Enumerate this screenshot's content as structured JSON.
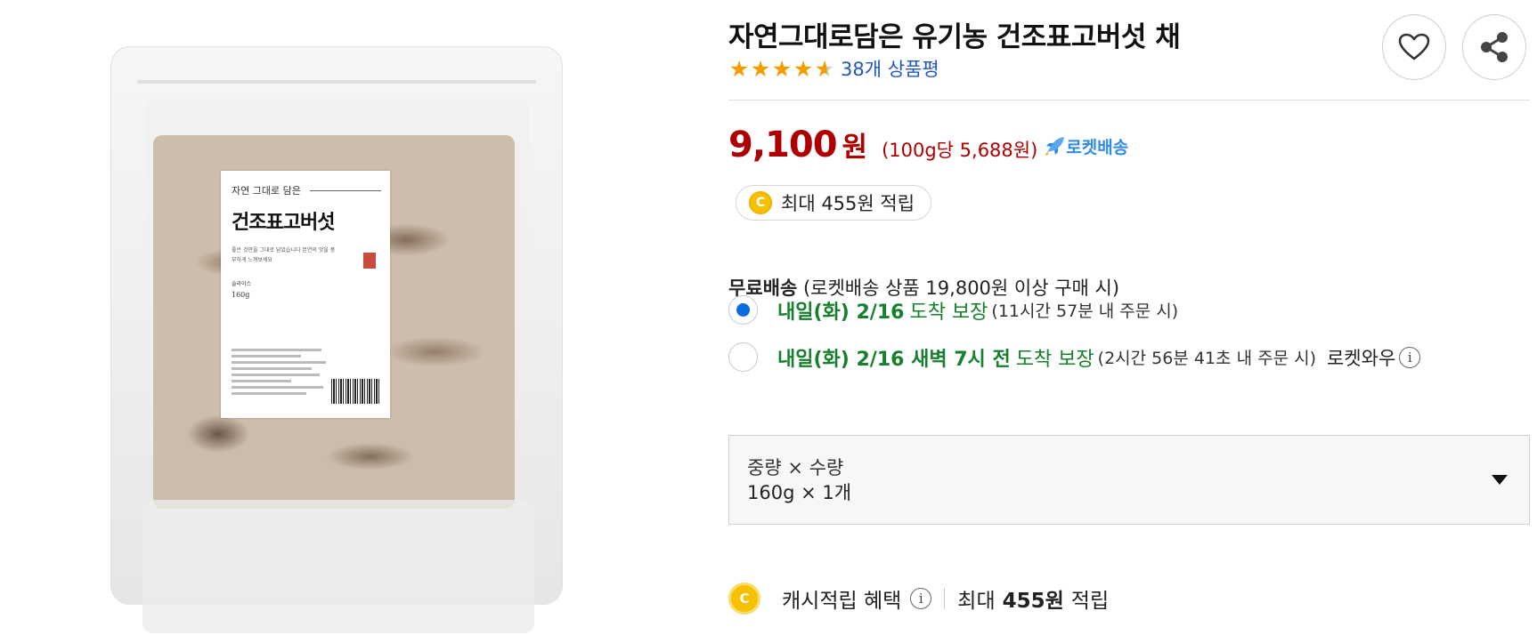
{
  "product_image": {
    "label_small": "자연 그대로 담은",
    "label_big": "건조표고버섯",
    "label_tagline": "좋은 것만을 그대로 담았습니다 본연의 맛을 풍부하게 느껴보세요",
    "label_slice": "슬라이스",
    "label_weight": "160g"
  },
  "product": {
    "title": "자연그대로담은 유기농 건조표고버섯 채",
    "rating": 4.5,
    "review_count": "38개 상품평"
  },
  "price": {
    "amount": "9,100",
    "currency": "원",
    "unit_price": "(100g당 5,688원)",
    "rocket_label": "로켓배송"
  },
  "cash_reward": {
    "coin": "C",
    "text": "최대 455원 적립"
  },
  "shipping": {
    "free_label": "무료배송",
    "free_condition": "(로켓배송 상품 19,800원 이상 구매 시)"
  },
  "delivery_options": [
    {
      "selected": true,
      "date": "내일(화) 2/16",
      "guarantee": "도착 보장",
      "condition": "(11시간 57분 내 주문 시)"
    },
    {
      "selected": false,
      "date": "내일(화) 2/16 새벽 7시 전",
      "guarantee": "도착 보장",
      "condition": "(2시간 56분 41초 내 주문 시)",
      "badge": "로켓와우",
      "info_icon": "i"
    }
  ],
  "option_select": {
    "label": "중량 × 수량",
    "value": "160g × 1개"
  },
  "cash_benefit": {
    "coin": "C",
    "label": "캐시적립 혜택",
    "info_icon": "i",
    "prefix": "최대",
    "amount": "455원",
    "suffix": "적립"
  },
  "colors": {
    "price": "#ae0000",
    "delivery_green": "#16802c",
    "link_blue": "#2156c4",
    "star": "#f29c00",
    "radio_selected": "#0a6be3",
    "coin": "#f7c000"
  }
}
